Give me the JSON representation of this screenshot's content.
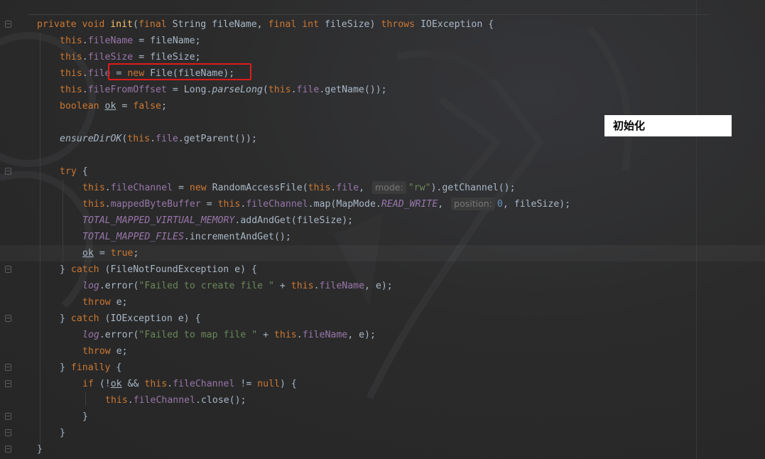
{
  "annotation": {
    "note_text": "初始化"
  },
  "hints": {
    "mode": "mode:",
    "position": "position:"
  },
  "code": {
    "l1": {
      "a": "private void ",
      "b": "init",
      "c": "(",
      "d": "final ",
      "e": "String fileName, ",
      "f": "final int ",
      "g": "fileSize) ",
      "h": "throws ",
      "i": "IOException {"
    },
    "l2": {
      "a": "this",
      "b": ".",
      "c": "fileName",
      "d": " = fileName;"
    },
    "l3": {
      "a": "this",
      "b": ".",
      "c": "fileSize",
      "d": " = fileSize;"
    },
    "l4": {
      "a": "this",
      "b": ".",
      "c": "file",
      "d": " = ",
      "e": "new ",
      "f": "File(fileName);"
    },
    "l5": {
      "a": "this",
      "b": ".",
      "c": "fileFromOffset",
      "d": " = Long.",
      "e": "parseLong",
      "f": "(",
      "g": "this",
      "h": ".",
      "i": "file",
      "j": ".getName());"
    },
    "l6": {
      "a": "boolean ",
      "b": "ok",
      "c": " = ",
      "d": "false",
      "e": ";"
    },
    "l8": {
      "a": "ensureDirOK",
      "b": "(",
      "c": "this",
      "d": ".",
      "e": "file",
      "f": ".getParent());"
    },
    "l10": {
      "a": "try ",
      "b": "{"
    },
    "l11": {
      "a": "this",
      "b": ".",
      "c": "fileChannel",
      "d": " = ",
      "e": "new ",
      "f": "RandomAccessFile(",
      "g": "this",
      "h": ".",
      "i": "file",
      "j": ", ",
      "k": "\"rw\"",
      "l": ").getChannel();"
    },
    "l12": {
      "a": "this",
      "b": ".",
      "c": "mappedByteBuffer",
      "d": " = ",
      "e": "this",
      "f": ".",
      "g": "fileChannel",
      "h": ".map(MapMode.",
      "i": "READ_WRITE",
      "j": ", ",
      "k": "0",
      "l": ", fileSize);"
    },
    "l13": {
      "a": "TOTAL_MAPPED_VIRTUAL_MEMORY",
      "b": ".addAndGet(fileSize);"
    },
    "l14": {
      "a": "TOTAL_MAPPED_FILES",
      "b": ".incrementAndGet();"
    },
    "l15": {
      "a": "ok",
      "b": " = ",
      "c": "true",
      "d": ";"
    },
    "l16": {
      "a": "} ",
      "b": "catch ",
      "c": "(FileNotFoundException e) {"
    },
    "l17": {
      "a": "log",
      "b": ".error(",
      "c": "\"Failed to create file \"",
      "d": " + ",
      "e": "this",
      "f": ".",
      "g": "fileName",
      "h": ", e);"
    },
    "l18": {
      "a": "throw ",
      "b": "e;"
    },
    "l19": {
      "a": "} ",
      "b": "catch ",
      "c": "(IOException e) {"
    },
    "l20": {
      "a": "log",
      "b": ".error(",
      "c": "\"Failed to map file \"",
      "d": " + ",
      "e": "this",
      "f": ".",
      "g": "fileName",
      "h": ", e);"
    },
    "l21": {
      "a": "throw ",
      "b": "e;"
    },
    "l22": {
      "a": "} ",
      "b": "finally ",
      "c": "{"
    },
    "l23": {
      "a": "if ",
      "b": "(!",
      "c": "ok",
      "d": " && ",
      "e": "this",
      "f": ".",
      "g": "fileChannel",
      "h": " != ",
      "i": "null",
      "j": ") {"
    },
    "l24": {
      "a": "this",
      "b": ".",
      "c": "fileChannel",
      "d": ".close();"
    },
    "l25": {
      "a": "}"
    },
    "l26": {
      "a": "}"
    },
    "l27": {
      "a": "}"
    }
  }
}
